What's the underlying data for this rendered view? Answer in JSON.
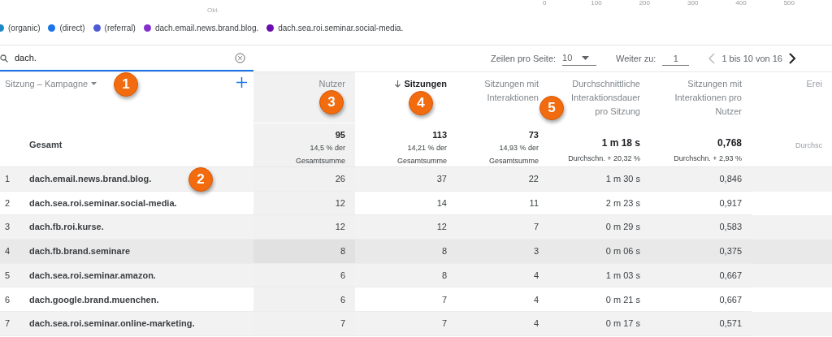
{
  "chart_axis": {
    "ticks": [
      "0",
      "100",
      "200",
      "300",
      "400",
      "500"
    ],
    "month_label": "Okt."
  },
  "legend": [
    {
      "label": "(organic)",
      "color": "#1e88c8"
    },
    {
      "label": "(direct)",
      "color": "#1a73e8"
    },
    {
      "label": "(referral)",
      "color": "#4f5bd5"
    },
    {
      "label": "dach.email.news.brand.blog.",
      "color": "#8430ce"
    },
    {
      "label": "dach.sea.roi.seminar.social-media.",
      "color": "#6a0dad"
    }
  ],
  "search": {
    "value": "dach."
  },
  "pagination": {
    "rows_label": "Zeilen pro Seite:",
    "rows_value": "10",
    "goto_label": "Weiter zu:",
    "goto_value": "1",
    "range": "1 bis 10 von 16",
    "prev_disabled": true
  },
  "dimension": {
    "label": "Sitzung – Kampagne",
    "total_label": "Gesamt"
  },
  "columns": [
    {
      "label_lines": [
        "Nutzer"
      ],
      "sorted": false,
      "highlighted": true,
      "total": "95",
      "total_sub_lines": [
        "14,5 % der",
        "Gesamtsumme"
      ]
    },
    {
      "label_lines": [
        "Sitzungen"
      ],
      "sorted": true,
      "highlighted": false,
      "total": "113",
      "total_sub_lines": [
        "14,21 % der",
        "Gesamtsumme"
      ]
    },
    {
      "label_lines": [
        "Sitzungen mit",
        "Interaktionen"
      ],
      "sorted": false,
      "highlighted": false,
      "total": "73",
      "total_sub_lines": [
        "14,93 % der",
        "Gesamtsumme"
      ]
    },
    {
      "label_lines": [
        "Durchschnittliche",
        "Interaktionsdauer",
        "pro Sitzung"
      ],
      "sorted": false,
      "highlighted": false,
      "total": "1 m 18 s",
      "total_sub_lines": [
        "Durchschn. + 20,32 %"
      ]
    },
    {
      "label_lines": [
        "Sitzungen mit",
        "Interaktionen pro",
        "Nutzer"
      ],
      "sorted": false,
      "highlighted": false,
      "total": "0,768",
      "total_sub_lines": [
        "Durchschn. + 2,93 %"
      ]
    },
    {
      "label_lines": [
        "Erei"
      ],
      "sorted": false,
      "highlighted": false,
      "faded": true,
      "total_sub_lines": [
        "Durchsc"
      ]
    }
  ],
  "rows": [
    {
      "index": "1",
      "name": "dach.email.news.brand.blog.",
      "values": [
        "26",
        "37",
        "22",
        "1 m 30 s",
        "0,846"
      ],
      "shaded": true,
      "hovered": false
    },
    {
      "index": "2",
      "name": "dach.sea.roi.seminar.social-media.",
      "values": [
        "12",
        "14",
        "11",
        "2 m 23 s",
        "0,917"
      ],
      "shaded": false,
      "hovered": false
    },
    {
      "index": "3",
      "name": "dach.fb.roi.kurse.",
      "values": [
        "12",
        "12",
        "7",
        "0 m 29 s",
        "0,583"
      ],
      "shaded": true,
      "hovered": false
    },
    {
      "index": "4",
      "name": "dach.fb.brand.seminare",
      "values": [
        "8",
        "8",
        "3",
        "0 m 06 s",
        "0,375"
      ],
      "shaded": true,
      "hovered": true
    },
    {
      "index": "5",
      "name": "dach.sea.roi.seminar.amazon.",
      "values": [
        "6",
        "8",
        "4",
        "1 m 03 s",
        "0,667"
      ],
      "shaded": true,
      "hovered": false
    },
    {
      "index": "6",
      "name": "dach.google.brand.muenchen.",
      "values": [
        "6",
        "7",
        "4",
        "0 m 21 s",
        "0,667"
      ],
      "shaded": false,
      "hovered": false
    },
    {
      "index": "7",
      "name": "dach.sea.roi.seminar.online-marketing.",
      "values": [
        "7",
        "7",
        "4",
        "0 m 17 s",
        "0,571"
      ],
      "shaded": true,
      "hovered": false
    }
  ],
  "callouts": [
    "1",
    "2",
    "3",
    "4",
    "5"
  ]
}
